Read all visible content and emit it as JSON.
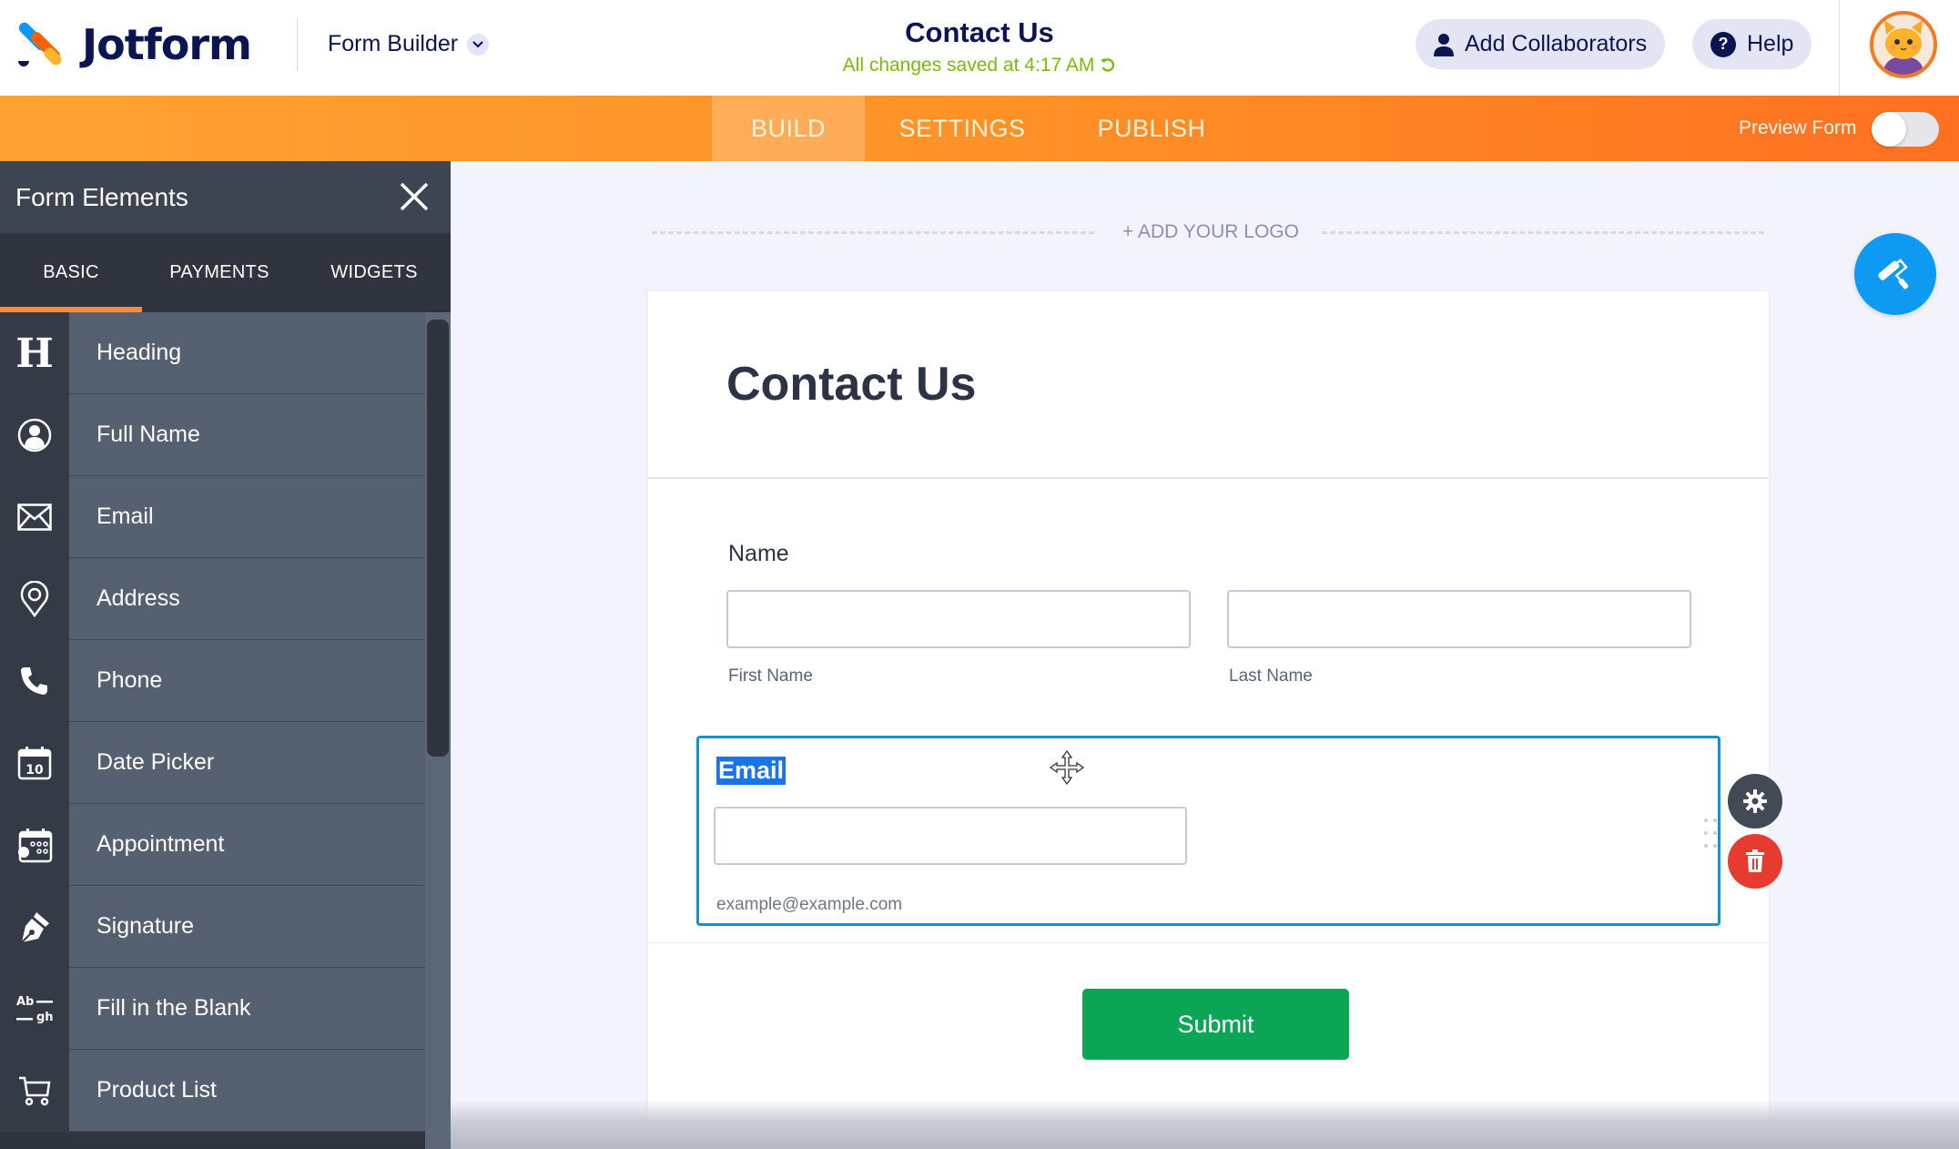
{
  "header": {
    "brand": "Jotform",
    "builder_switch": "Form Builder",
    "form_title": "Contact Us",
    "save_status": "All changes saved at 4:17 AM",
    "add_collaborators": "Add Collaborators",
    "help": "Help"
  },
  "nav": {
    "tabs": [
      {
        "label": "BUILD",
        "active": true
      },
      {
        "label": "SETTINGS",
        "active": false
      },
      {
        "label": "PUBLISH",
        "active": false
      }
    ],
    "preview_label": "Preview Form",
    "preview_on": false
  },
  "sidebar": {
    "title": "Form Elements",
    "tabs": [
      {
        "label": "BASIC",
        "active": true
      },
      {
        "label": "PAYMENTS",
        "active": false
      },
      {
        "label": "WIDGETS",
        "active": false
      }
    ],
    "items": [
      {
        "label": "Heading",
        "icon": "heading-icon"
      },
      {
        "label": "Full Name",
        "icon": "user-circle-icon"
      },
      {
        "label": "Email",
        "icon": "envelope-icon"
      },
      {
        "label": "Address",
        "icon": "map-pin-icon"
      },
      {
        "label": "Phone",
        "icon": "phone-icon"
      },
      {
        "label": "Date Picker",
        "icon": "calendar-icon",
        "icon_text": "10"
      },
      {
        "label": "Appointment",
        "icon": "appointment-calendar-icon"
      },
      {
        "label": "Signature",
        "icon": "pen-nib-icon"
      },
      {
        "label": "Fill in the Blank",
        "icon": "fill-blank-icon",
        "icon_text_top": "Ab",
        "icon_text_bottom": "gh"
      },
      {
        "label": "Product List",
        "icon": "cart-icon"
      }
    ]
  },
  "canvas": {
    "add_logo": "+ ADD YOUR LOGO",
    "form_heading": "Contact Us",
    "name_field": {
      "label": "Name",
      "first_value": "",
      "last_value": "",
      "first_sublabel": "First Name",
      "last_sublabel": "Last Name"
    },
    "email_field": {
      "label": "Email",
      "value": "",
      "sublabel": "example@example.com",
      "selected": true
    },
    "submit_label": "Submit"
  },
  "colors": {
    "brand_navy": "#0a1551",
    "nav_orange": "#ff9227",
    "save_green": "#78bb07",
    "selection_blue": "#0f91d2",
    "submit_green": "#0aa655",
    "delete_red": "#e63b2e",
    "roller_blue": "#0e9af2"
  }
}
